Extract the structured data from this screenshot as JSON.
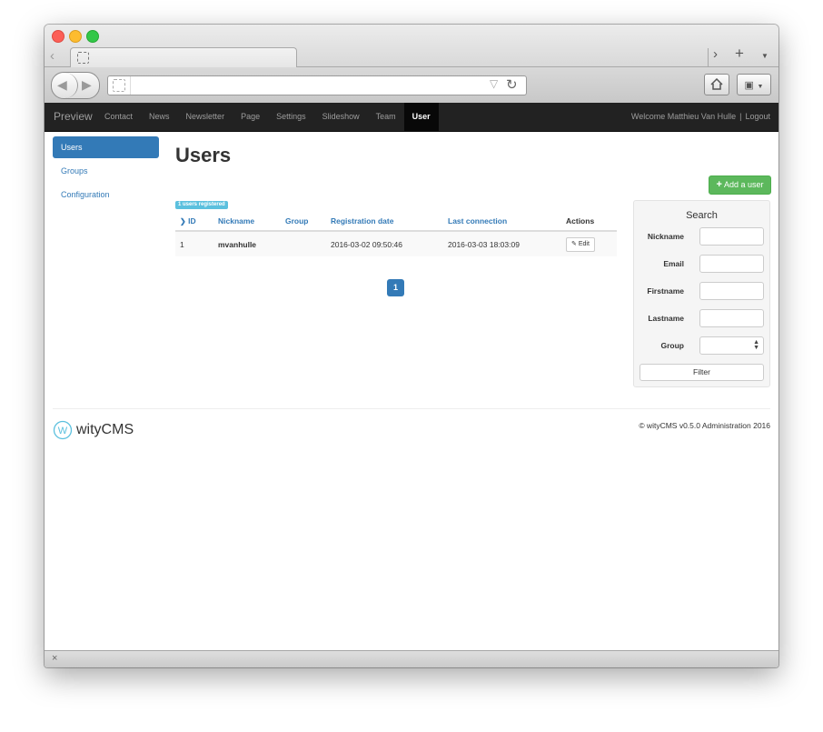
{
  "browser": {
    "close_glyph": "×"
  },
  "nav": {
    "brand": "Preview",
    "items": [
      "Contact",
      "News",
      "Newsletter",
      "Page",
      "Settings",
      "Slideshow",
      "Team",
      "User"
    ],
    "active": "User",
    "welcome": "Welcome Matthieu Van Hulle",
    "separator": "|",
    "logout": "Logout"
  },
  "sidebar": {
    "items": [
      "Users",
      "Groups",
      "Configuration"
    ],
    "active": "Users"
  },
  "main": {
    "title": "Users",
    "add_user_label": "Add a user",
    "registered_badge": "1 users registered",
    "table": {
      "columns": [
        "ID",
        "Nickname",
        "Group",
        "Registration date",
        "Last connection",
        "Actions"
      ],
      "rows": [
        {
          "id": "1",
          "nickname": "mvanhulle",
          "group": "",
          "registration_date": "2016-03-02 09:50:46",
          "last_connection": "2016-03-03 18:03:09",
          "action": "Edit"
        }
      ]
    },
    "pagination": {
      "current": "1"
    }
  },
  "search": {
    "title": "Search",
    "fields": [
      "Nickname",
      "Email",
      "Firstname",
      "Lastname",
      "Group"
    ],
    "filter_label": "Filter"
  },
  "footer": {
    "logo_text": "wityCMS",
    "logo_letter": "W",
    "copyright": "© wityCMS v0.5.0 Administration 2016"
  },
  "colors": {
    "navbar_bg": "#222222",
    "primary": "#337ab7",
    "success": "#5cb85c",
    "info": "#5bc0de",
    "logo_accent": "#5bc0de"
  },
  "icons": [
    "back-arrow-icon",
    "forward-arrow-icon",
    "reload-icon",
    "rss-icon",
    "home-icon",
    "bookmark-icon",
    "new-tab-icon",
    "plus-icon",
    "pencil-icon",
    "sort-chevron-icon",
    "close-icon"
  ]
}
